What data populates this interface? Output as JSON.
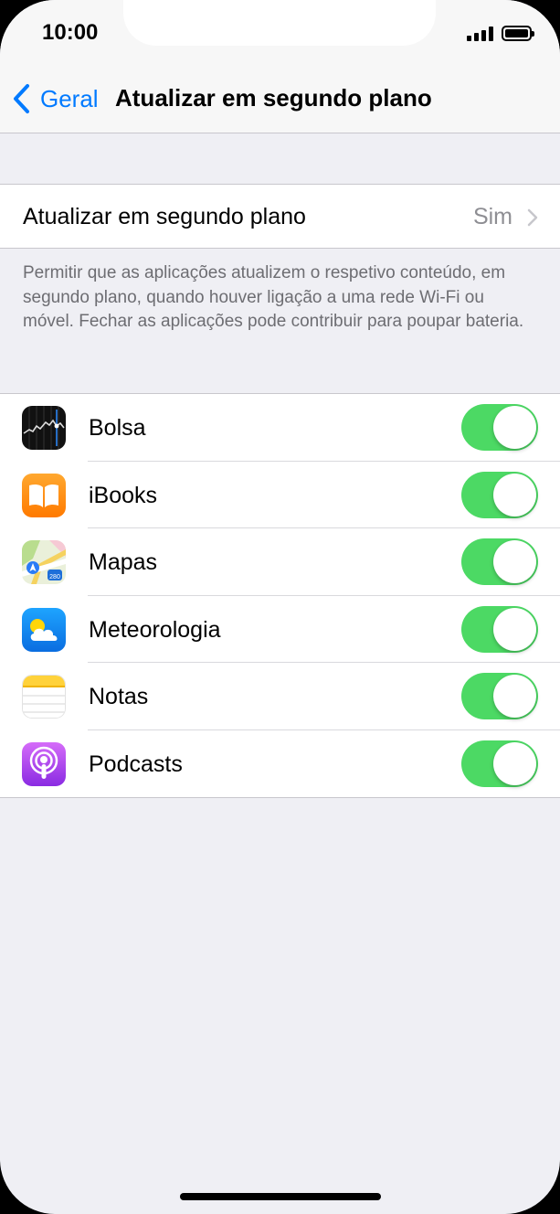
{
  "status_bar": {
    "time": "10:00"
  },
  "nav": {
    "back_label": "Geral",
    "title": "Atualizar em segundo plano"
  },
  "main_setting": {
    "label": "Atualizar em segundo plano",
    "value": "Sim"
  },
  "footer": {
    "text": "Permitir que as aplicações atualizem o respetivo conteúdo, em segundo plano, quando houver ligação a uma rede Wi-Fi ou móvel. Fechar as aplicações pode contribuir para poupar bateria."
  },
  "apps": [
    {
      "name": "Bolsa",
      "icon": "stocks-icon",
      "enabled": true
    },
    {
      "name": "iBooks",
      "icon": "ibooks-icon",
      "enabled": true
    },
    {
      "name": "Mapas",
      "icon": "maps-icon",
      "enabled": true
    },
    {
      "name": "Meteorologia",
      "icon": "weather-icon",
      "enabled": true
    },
    {
      "name": "Notas",
      "icon": "notes-icon",
      "enabled": true
    },
    {
      "name": "Podcasts",
      "icon": "podcasts-icon",
      "enabled": true
    }
  ],
  "colors": {
    "accent": "#007aff",
    "toggle_on": "#4cd964",
    "background": "#efeff4"
  }
}
